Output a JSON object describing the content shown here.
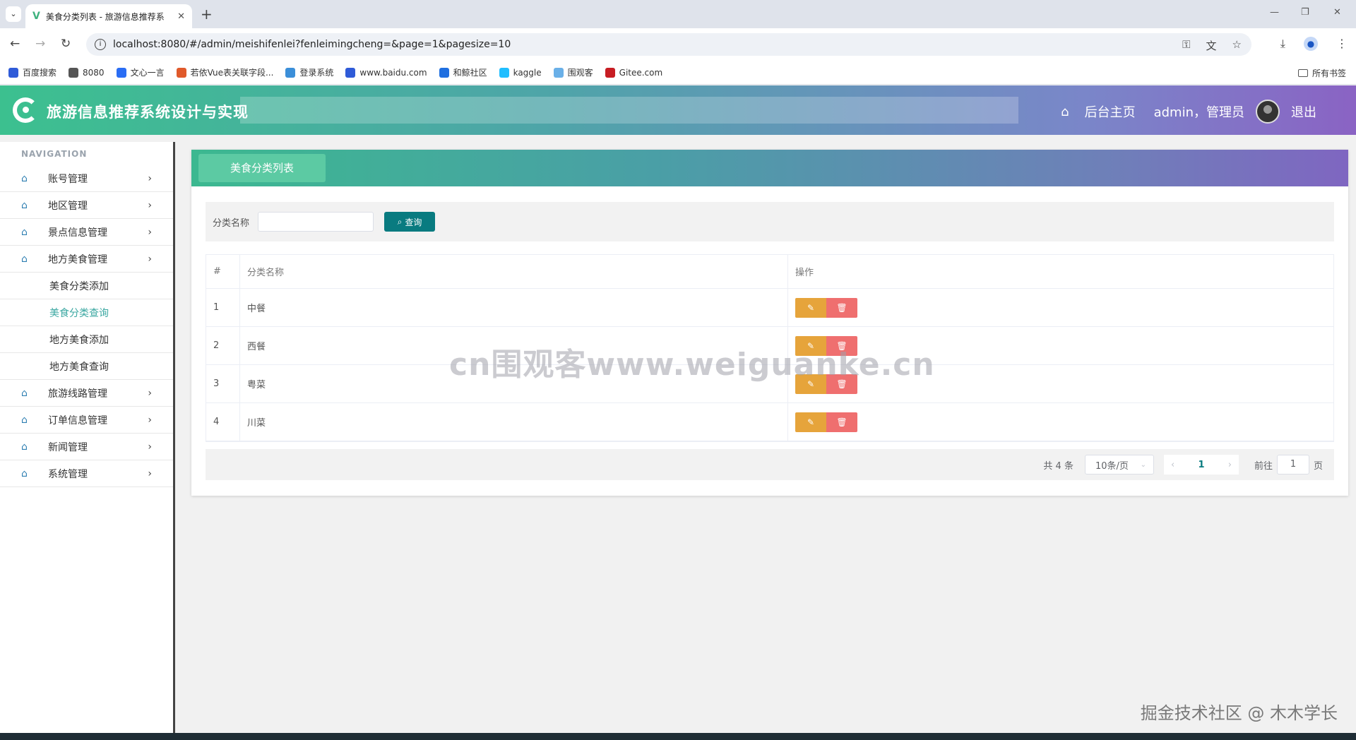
{
  "browser": {
    "tab_title": "美食分类列表 - 旅游信息推荐系",
    "tab_close": "✕",
    "new_tab": "+",
    "url": "localhost:8080/#/admin/meishifenlei?fenleimingcheng=&page=1&pagesize=10",
    "bookmarks": [
      {
        "label": "百度搜索",
        "color": "#2f5bd8",
        "icon": "paw-icon"
      },
      {
        "label": "8080",
        "color": "#555555",
        "icon": "globe-icon"
      },
      {
        "label": "文心一言",
        "color": "#2a6df4",
        "icon": "ernie-icon"
      },
      {
        "label": "若依Vue表关联字段...",
        "color": "#e05a2b",
        "icon": "ruoyi-icon"
      },
      {
        "label": "登录系统",
        "color": "#3b8fd9",
        "icon": "login-icon"
      },
      {
        "label": "www.baidu.com",
        "color": "#2f5bd8",
        "icon": "paw-icon"
      },
      {
        "label": "和鲸社区",
        "color": "#1f6fe0",
        "icon": "heywhale-icon"
      },
      {
        "label": "kaggle",
        "color": "#20beff",
        "icon": "kaggle-icon"
      },
      {
        "label": "围观客",
        "color": "#6ab0e8",
        "icon": "weiguanke-icon"
      },
      {
        "label": "Gitee.com",
        "color": "#c71d23",
        "icon": "gitee-icon"
      }
    ],
    "all_bookmarks": "所有书签"
  },
  "header": {
    "title": "旅游信息推荐系统设计与实现",
    "home_link": "后台主页",
    "user": "admin，管理员",
    "logout": "退出"
  },
  "sidebar": {
    "caption": "NAVIGATION",
    "items": [
      {
        "label": "账号管理",
        "expandable": true
      },
      {
        "label": "地区管理",
        "expandable": true
      },
      {
        "label": "景点信息管理",
        "expandable": true
      },
      {
        "label": "地方美食管理",
        "expandable": true
      },
      {
        "label": "美食分类添加",
        "sub": true
      },
      {
        "label": "美食分类查询",
        "sub": true,
        "active": true
      },
      {
        "label": "地方美食添加",
        "sub": true
      },
      {
        "label": "地方美食查询",
        "sub": true
      },
      {
        "label": "旅游线路管理",
        "expandable": true
      },
      {
        "label": "订单信息管理",
        "expandable": true
      },
      {
        "label": "新闻管理",
        "expandable": true
      },
      {
        "label": "系统管理",
        "expandable": true
      }
    ]
  },
  "panel": {
    "tab_label": "美食分类列表",
    "search_label": "分类名称",
    "search_value": "",
    "search_button": "查询",
    "table": {
      "headers": [
        "#",
        "分类名称",
        "操作"
      ],
      "rows": [
        {
          "index": "1",
          "name": "中餐"
        },
        {
          "index": "2",
          "name": "西餐"
        },
        {
          "index": "3",
          "name": "粤菜"
        },
        {
          "index": "4",
          "name": "川菜"
        }
      ]
    },
    "pagination": {
      "total": "共 4 条",
      "page_size": "10条/页",
      "current_page": "1",
      "goto_label": "前往",
      "goto_value": "1",
      "page_unit": "页"
    }
  },
  "watermarks": {
    "center": "cn围观客www.weiguanke.cn",
    "corner": "掘金技术社区 @ 木木学长"
  },
  "colors": {
    "accent_teal": "#097b80",
    "edit": "#e6a43b",
    "delete": "#ef6f6f",
    "active_menu": "#3aa7a1"
  }
}
